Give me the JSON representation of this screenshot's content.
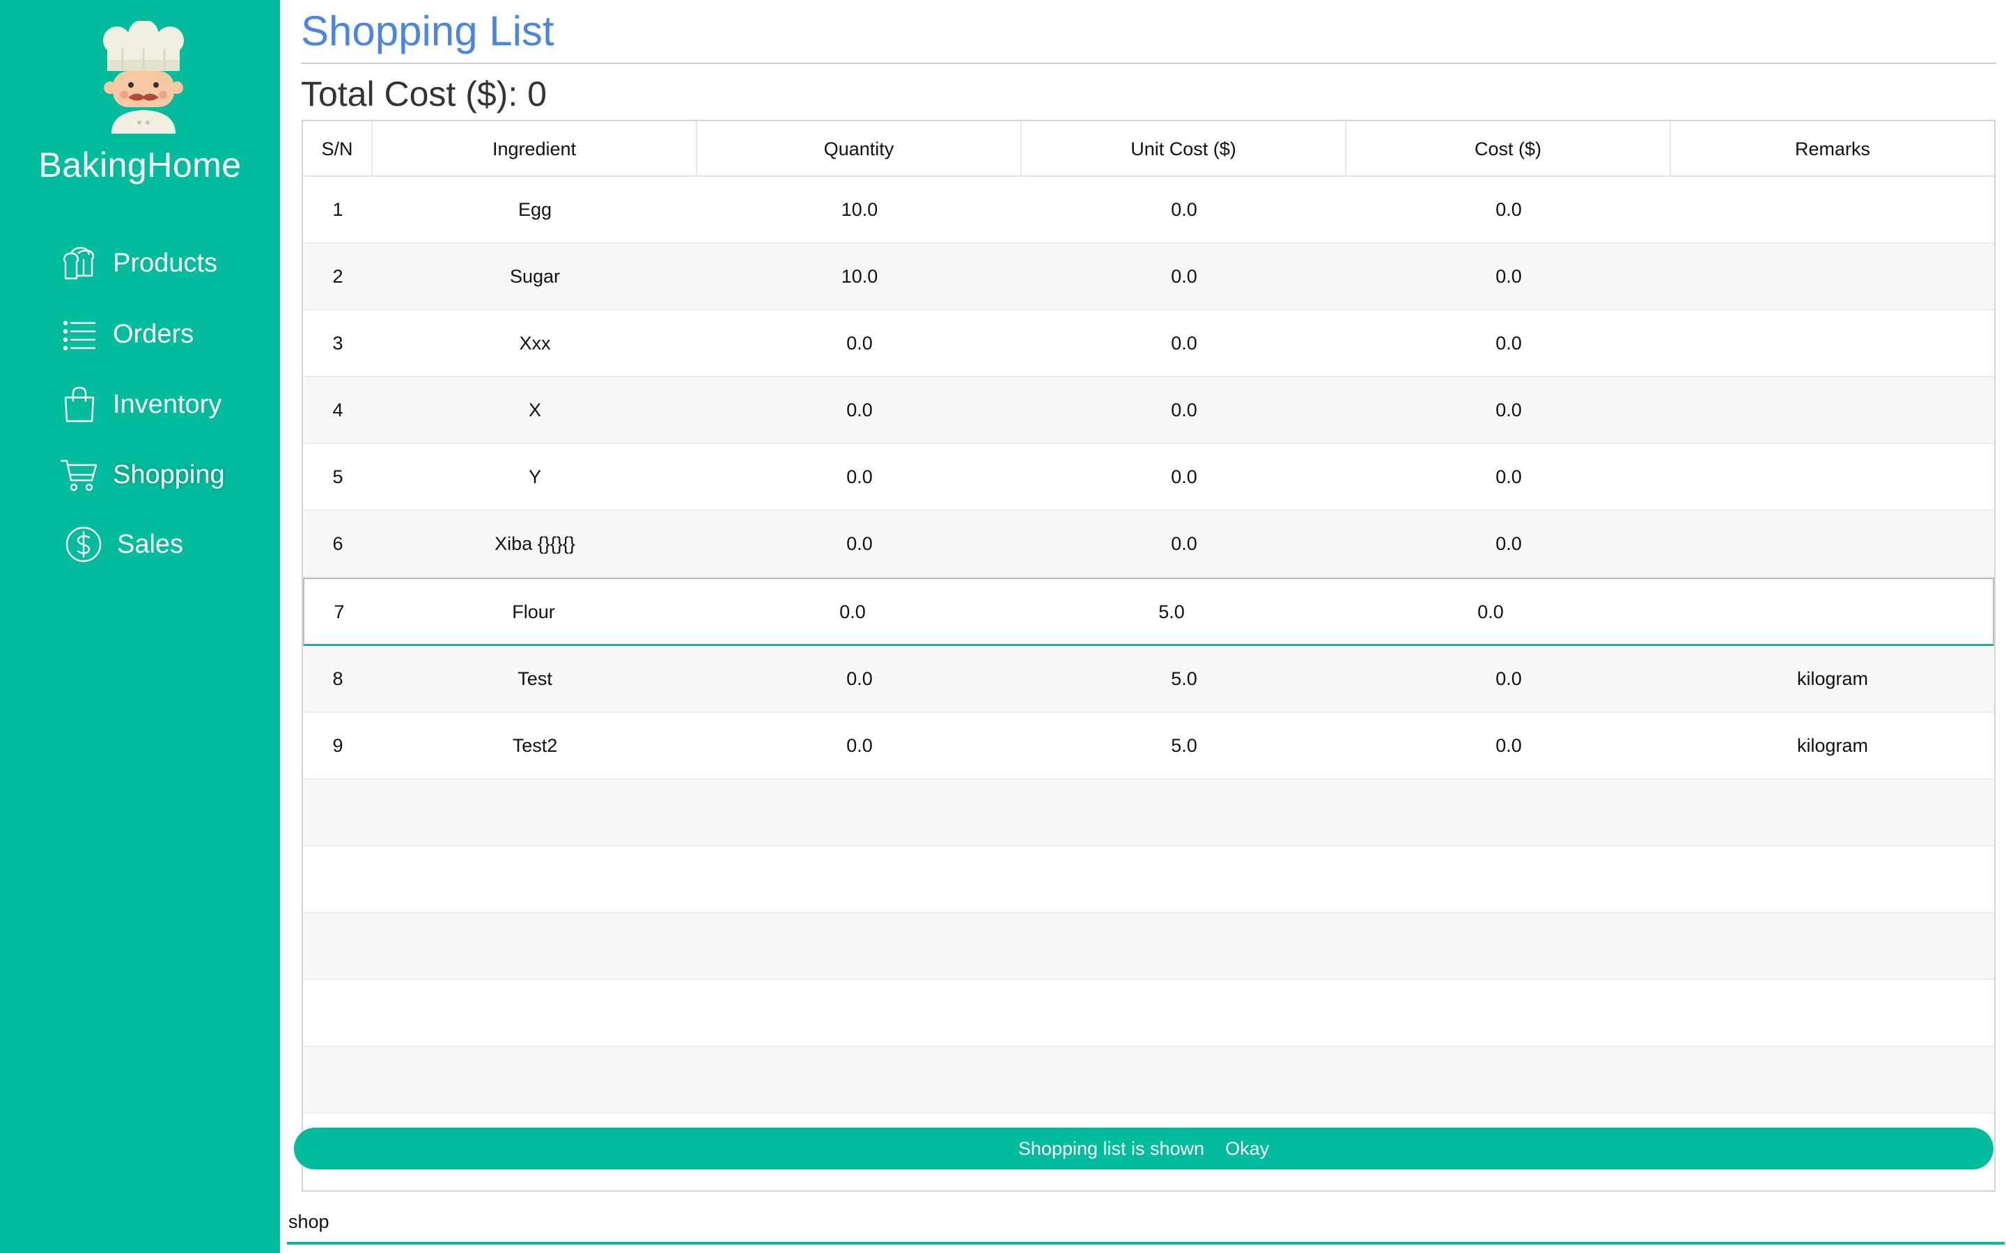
{
  "app": {
    "brand": "BakingHome",
    "accent": "#00bb9c",
    "title_color": "#4a86e0"
  },
  "sidebar": {
    "items": [
      {
        "label": "Products",
        "icon": "bread-icon"
      },
      {
        "label": "Orders",
        "icon": "list-icon"
      },
      {
        "label": "Inventory",
        "icon": "bag-icon"
      },
      {
        "label": "Shopping",
        "icon": "cart-icon",
        "active": true
      },
      {
        "label": "Sales",
        "icon": "dollar-circle-icon"
      }
    ]
  },
  "main": {
    "title": "Shopping List",
    "total_label": "Total Cost ($): 0"
  },
  "table": {
    "columns": [
      "S/N",
      "Ingredient",
      "Quantity",
      "Unit Cost ($)",
      "Cost ($)",
      "Remarks"
    ],
    "rows": [
      [
        "1",
        "Egg",
        "10.0",
        "0.0",
        "0.0",
        ""
      ],
      [
        "2",
        "Sugar",
        "10.0",
        "0.0",
        "0.0",
        ""
      ],
      [
        "3",
        "Xxx",
        "0.0",
        "0.0",
        "0.0",
        ""
      ],
      [
        "4",
        "X",
        "0.0",
        "0.0",
        "0.0",
        ""
      ],
      [
        "5",
        "Y",
        "0.0",
        "0.0",
        "0.0",
        ""
      ],
      [
        "6",
        "Xiba {}{}{}",
        "0.0",
        "0.0",
        "0.0",
        ""
      ],
      [
        "7",
        "Flour",
        "0.0",
        "5.0",
        "0.0",
        ""
      ],
      [
        "8",
        "Test",
        "0.0",
        "5.0",
        "0.0",
        "kilogram"
      ],
      [
        "9",
        "Test2",
        "0.0",
        "5.0",
        "0.0",
        "kilogram"
      ]
    ],
    "selected_row": 6,
    "empty_rows": 5
  },
  "toast": {
    "message": "Shopping list is shown",
    "action": "Okay"
  },
  "command": {
    "value": "shop"
  }
}
